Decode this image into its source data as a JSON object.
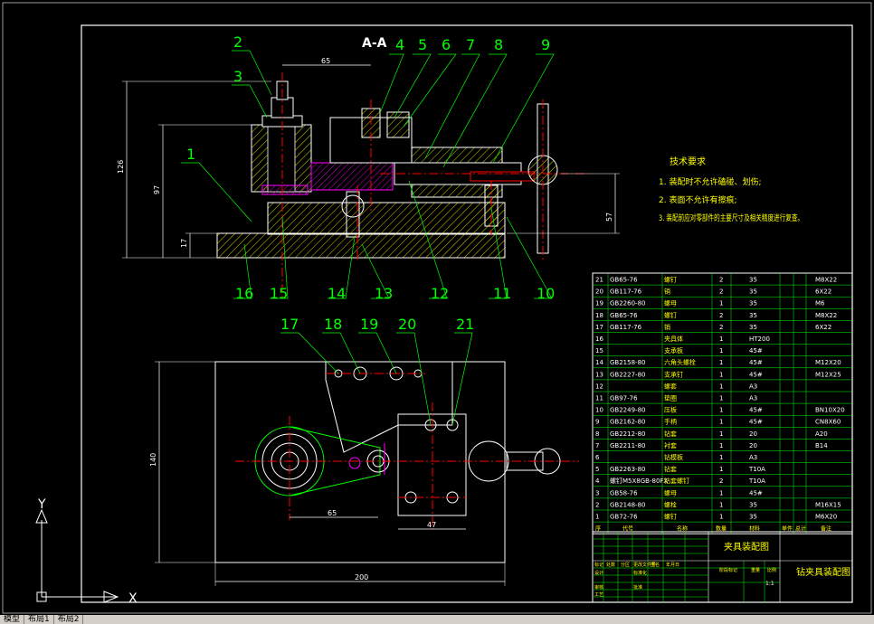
{
  "section_title": "A-A",
  "callouts": [
    "1",
    "2",
    "3",
    "4",
    "5",
    "6",
    "7",
    "8",
    "9",
    "10",
    "11",
    "12",
    "13",
    "14",
    "15",
    "16",
    "17",
    "18",
    "19",
    "20",
    "21"
  ],
  "dimensions": {
    "top_width": "65",
    "height_total": "126",
    "height_mid": "97",
    "height_small": "17",
    "right_height": "57",
    "plan_height": "140",
    "plan_65": "65",
    "plan_47": "47",
    "plan_width": "200"
  },
  "tech_req": {
    "title": "技术要求",
    "items": [
      "1. 装配时不允许磕碰、划伤;",
      "2. 表面不允许有擦痕;",
      "3. 装配前应对零部件的主要尺寸及相关精度进行复查。"
    ]
  },
  "bom": [
    {
      "no": "21",
      "code": "GB65-76",
      "name": "螺钉",
      "qty": "2",
      "mat": "35",
      "note": "M8X22"
    },
    {
      "no": "20",
      "code": "GB117-76",
      "name": "销",
      "qty": "2",
      "mat": "35",
      "note": "6X22"
    },
    {
      "no": "19",
      "code": "GB2260-80",
      "name": "螺母",
      "qty": "1",
      "mat": "35",
      "note": "M6"
    },
    {
      "no": "18",
      "code": "GB65-76",
      "name": "螺钉",
      "qty": "2",
      "mat": "35",
      "note": "M8X22"
    },
    {
      "no": "17",
      "code": "GB117-76",
      "name": "销",
      "qty": "2",
      "mat": "35",
      "note": "6X22"
    },
    {
      "no": "16",
      "code": "",
      "name": "夹具体",
      "qty": "1",
      "mat": "HT200",
      "note": ""
    },
    {
      "no": "15",
      "code": "",
      "name": "支承板",
      "qty": "1",
      "mat": "45#",
      "note": ""
    },
    {
      "no": "14",
      "code": "GB2158-80",
      "name": "六角头螺栓",
      "qty": "1",
      "mat": "45#",
      "note": "M12X20"
    },
    {
      "no": "13",
      "code": "GB2227-80",
      "name": "支承钉",
      "qty": "1",
      "mat": "45#",
      "note": "M12X25"
    },
    {
      "no": "12",
      "code": "",
      "name": "螺套",
      "qty": "1",
      "mat": "A3",
      "note": ""
    },
    {
      "no": "11",
      "code": "GB97-76",
      "name": "垫圈",
      "qty": "1",
      "mat": "A3",
      "note": ""
    },
    {
      "no": "10",
      "code": "GB2249-80",
      "name": "压板",
      "qty": "1",
      "mat": "45#",
      "note": "BN10X20"
    },
    {
      "no": "9",
      "code": "GB2162-80",
      "name": "手柄",
      "qty": "1",
      "mat": "45#",
      "note": "CN8X60"
    },
    {
      "no": "8",
      "code": "GB2212-80",
      "name": "钻套",
      "qty": "1",
      "mat": "20",
      "note": "A20"
    },
    {
      "no": "7",
      "code": "GB2211-80",
      "name": "衬套",
      "qty": "1",
      "mat": "20",
      "note": "B14"
    },
    {
      "no": "6",
      "code": "",
      "name": "钻模板",
      "qty": "1",
      "mat": "A3",
      "note": ""
    },
    {
      "no": "5",
      "code": "GB2263-80",
      "name": "钻套",
      "qty": "1",
      "mat": "T10A",
      "note": ""
    },
    {
      "no": "4",
      "code": "螺钉M5X8GB-80FX",
      "name": "钻套螺钉",
      "qty": "2",
      "mat": "T10A",
      "note": ""
    },
    {
      "no": "3",
      "code": "GB58-76",
      "name": "螺母",
      "qty": "1",
      "mat": "45#",
      "note": ""
    },
    {
      "no": "2",
      "code": "GB2148-80",
      "name": "螺栓",
      "qty": "1",
      "mat": "35",
      "note": "M16X15"
    },
    {
      "no": "1",
      "code": "GB72-76",
      "name": "螺钉",
      "qty": "1",
      "mat": "35",
      "note": "M6X20"
    }
  ],
  "bom_header": {
    "no": "序",
    "code": "代号",
    "name": "名称",
    "qty": "数量",
    "mat": "材料",
    "w1": "单件",
    "w2": "总计",
    "note": "备注"
  },
  "title_block": {
    "drawing_name": "夹具装配图",
    "drawing_title": "钻夹具装配图",
    "scale": "1:1",
    "labels": [
      "标记",
      "处数",
      "分区",
      "更改文件号",
      "签名",
      "年月日",
      "设计",
      "标准化",
      "审核",
      "工艺",
      "批准"
    ],
    "stage": "阶段标记",
    "weight": "重量",
    "ratio": "比例"
  },
  "ucs": {
    "x": "X",
    "y": "Y"
  },
  "tabs": [
    "模型",
    "布局1",
    "布局2"
  ]
}
